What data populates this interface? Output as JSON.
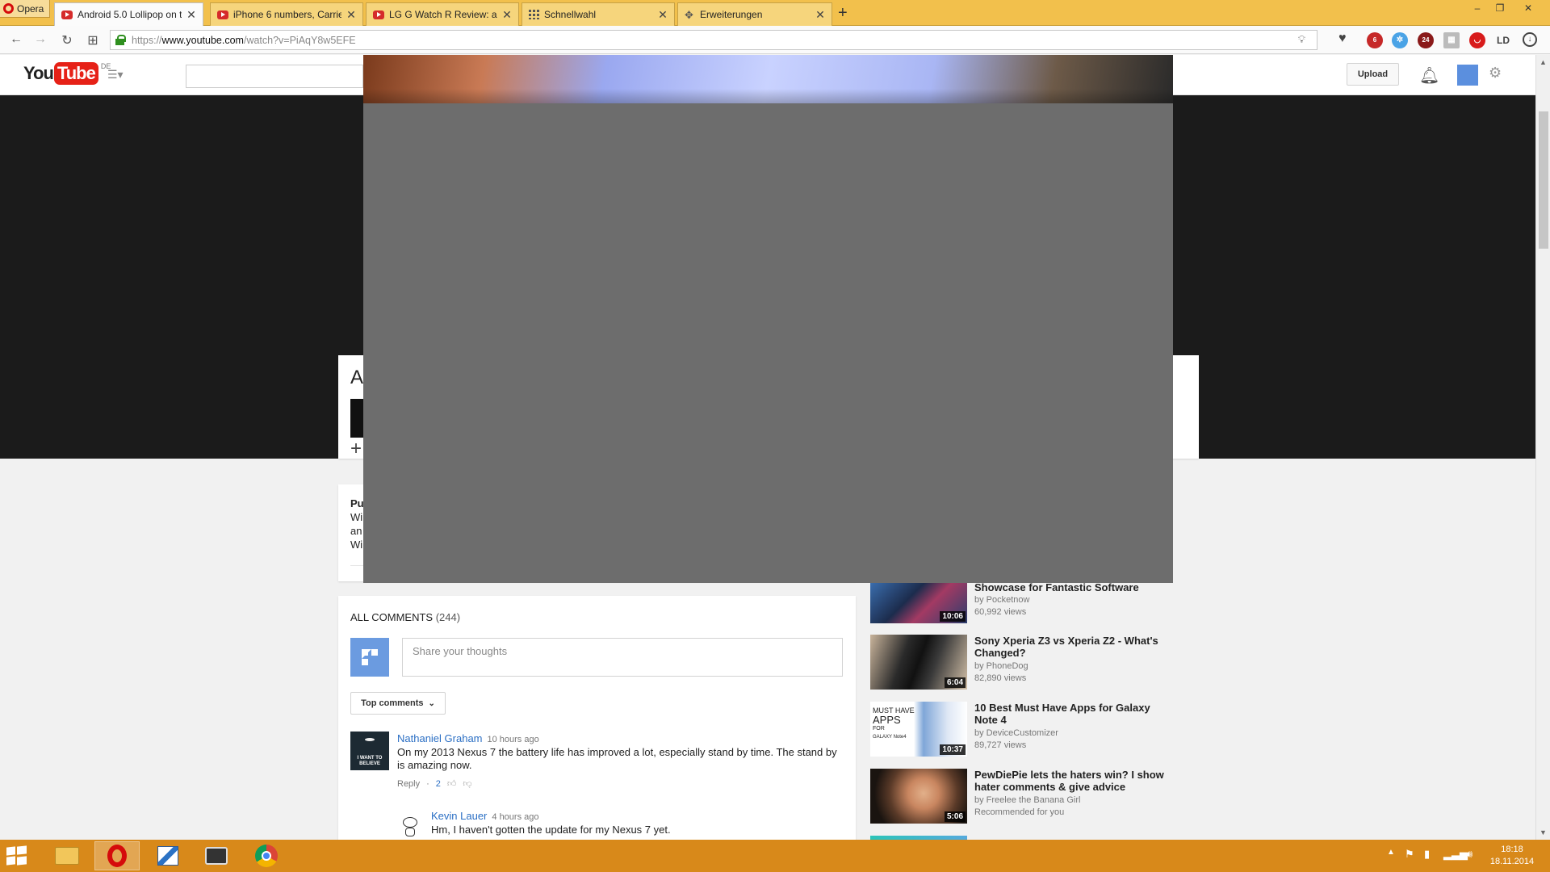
{
  "browser": {
    "menu_label": "Opera",
    "tabs": [
      {
        "label": "Android 5.0 Lollipop on th",
        "icon": "youtube-icon",
        "active": true
      },
      {
        "label": "iPhone 6 numbers, Carrier",
        "icon": "youtube-icon",
        "active": false
      },
      {
        "label": "LG G Watch R Review: a Sc",
        "icon": "youtube-icon",
        "active": false
      },
      {
        "label": "Schnellwahl",
        "icon": "speed-dial-icon",
        "active": false
      },
      {
        "label": "Erweiterungen",
        "icon": "puzzle-icon",
        "active": false
      }
    ],
    "new_tab": "+",
    "address": {
      "protocol": "https://",
      "host": "www.youtube.com",
      "path": "/watch?v=PiAqY8w5EFE"
    },
    "extension_badges": [
      "6",
      "24"
    ]
  },
  "youtube": {
    "logo_you": "You",
    "logo_tube": "Tube",
    "region": "DE",
    "upload_label": "Upload",
    "brand_red": "#e62117",
    "partial_title": "A",
    "partial_desc_lines": [
      "Pu",
      "Wi",
      "an",
      "Wi"
    ],
    "add_symbol": "+"
  },
  "comments": {
    "title": "ALL COMMENTS",
    "count": "(244)",
    "share_placeholder": "Share your thoughts",
    "sort_label": "Top comments",
    "items": [
      {
        "author": "Nathaniel Graham",
        "time": "10 hours ago",
        "text": "On my 2013 Nexus 7 the battery life has improved a lot, especially stand by time. The stand by is amazing now.",
        "reply": "Reply",
        "likes": "2",
        "avatar_caption": "I WANT TO BELIEVE"
      },
      {
        "author": "Kevin Lauer",
        "time": "4 hours ago",
        "text": "Hm, I haven't gotten the update for my Nexus 7 yet."
      }
    ]
  },
  "related": [
    {
      "title": "Showcase for Fantastic Software",
      "channel": "by Pocketnow",
      "meta": "60,992 views",
      "duration": "10:06"
    },
    {
      "title": "Sony Xperia Z3 vs Xperia Z2 - What's Changed?",
      "channel": "by PhoneDog",
      "meta": "82,890 views",
      "duration": "6:04"
    },
    {
      "title": "10 Best Must Have Apps for Galaxy Note 4",
      "channel": "by DeviceCustomizer",
      "meta": "89,727 views",
      "duration": "10:37",
      "thumb_text_1": "MUST HAVE",
      "thumb_text_2": "APPS",
      "thumb_text_3": "FOR",
      "thumb_text_4": "GALAXY Note4"
    },
    {
      "title": "PewDiePie lets the haters win? I show hater comments & give advice",
      "channel": "by Freelee the Banana Girl",
      "meta": "Recommended for you",
      "duration": "5:06"
    }
  ],
  "taskbar": {
    "time": "18:18",
    "date": "18.11.2014",
    "color": "#d8891a"
  }
}
